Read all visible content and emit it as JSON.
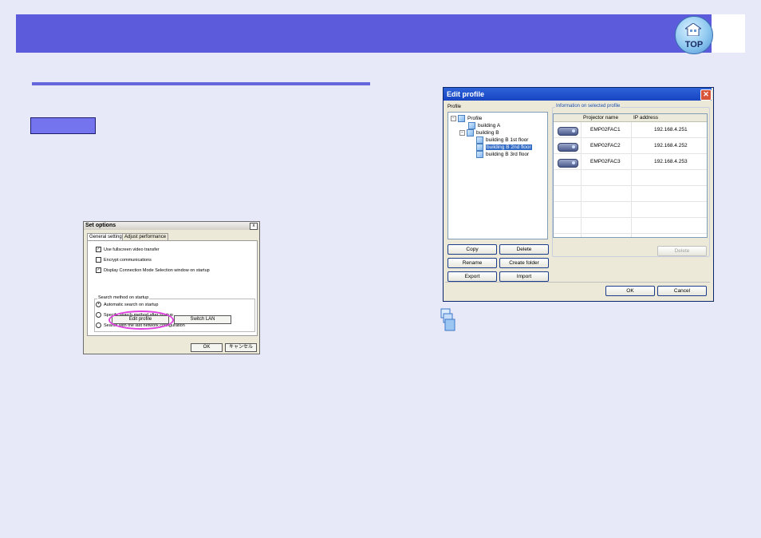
{
  "header": {
    "top_badge_label": "TOP"
  },
  "set_options_dialog": {
    "title": "Set options",
    "close_glyph": "x",
    "tabs": [
      "General settings",
      "Adjust performance"
    ],
    "checkboxes": [
      {
        "label": "Use fullscreen video transfer",
        "checked": true
      },
      {
        "label": "Encrypt communications",
        "checked": false
      },
      {
        "label": "Display Connection Mode Selection window on startup",
        "checked": true
      }
    ],
    "search_group_label": "Search method on startup",
    "radios": [
      {
        "label": "Automatic search on startup",
        "selected": true
      },
      {
        "label": "Specify search method after startup",
        "selected": false
      },
      {
        "label": "Search with the last network configuration",
        "selected": false
      }
    ],
    "edit_profile_button": "Edit profile",
    "switch_lan_button": "Switch LAN",
    "ok_button": "OK",
    "cancel_button": "キャンセル"
  },
  "edit_profile_dialog": {
    "title": "Edit profile",
    "close_glyph": "✕",
    "profile_label": "Profile",
    "tree": [
      {
        "label": "Profile",
        "expander": "−"
      },
      {
        "label": "building A"
      },
      {
        "label": "building B",
        "expander": "−"
      },
      {
        "label": "building B 1st floor"
      },
      {
        "label": "building B 2nd floor",
        "selected": true
      },
      {
        "label": "building B 3rd floor"
      }
    ],
    "info_group_label": "Information on selected profile",
    "columns": [
      "Projector name",
      "IP address"
    ],
    "rows": [
      {
        "name": "EMP02FAC1",
        "ip": "192.168.4.251"
      },
      {
        "name": "EMP02FAC2",
        "ip": "192.168.4.252"
      },
      {
        "name": "EMP02FAC3",
        "ip": "192.168.4.253"
      }
    ],
    "buttons": {
      "copy": "Copy",
      "delete": "Delete",
      "rename": "Rename",
      "create_folder": "Create folder",
      "export": "Export",
      "import": "Import",
      "delete_right": "Delete",
      "ok": "OK",
      "cancel": "Cancel"
    }
  },
  "colors": {
    "page_bg": "#e7e9f8",
    "header_bar": "#5b5bdb",
    "section_rule": "#6666dd",
    "procedure_badge": "#7474ee",
    "highlight_ellipse": "#e040e0",
    "dialog_titlebar": "#2d63d8"
  }
}
